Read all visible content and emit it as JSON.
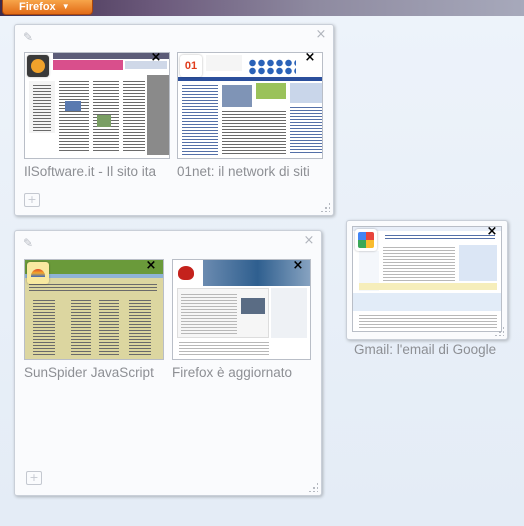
{
  "menu": {
    "firefox_label": "Firefox",
    "arrow": "▼"
  },
  "groups": [
    {
      "tabs": [
        {
          "title": "IlSoftware.it - Il sito ita",
          "favicon": "ilsoftware-favicon"
        },
        {
          "title": "01net: il network di siti",
          "favicon": "01net-favicon",
          "favicon_text": "01"
        }
      ]
    },
    {
      "tabs": [
        {
          "title": "SunSpider JavaScript",
          "favicon": "sunspider-favicon"
        },
        {
          "title": "Firefox è aggiornato",
          "favicon": "firefox-favicon"
        }
      ]
    }
  ],
  "orphan_tab": {
    "title": "Gmail: l'email di Google",
    "favicon": "google-favicon"
  },
  "icons": {
    "group_title_edit": "pencil-icon",
    "group_close": "close-icon",
    "new_tab": "new-tab-icon",
    "tab_close": "close-icon",
    "resize": "resize-grip-icon"
  },
  "colors": {
    "firefox_button": "#e26b16",
    "canvas_bg": "#e8eff8",
    "tab_title": "#8d8f94"
  }
}
